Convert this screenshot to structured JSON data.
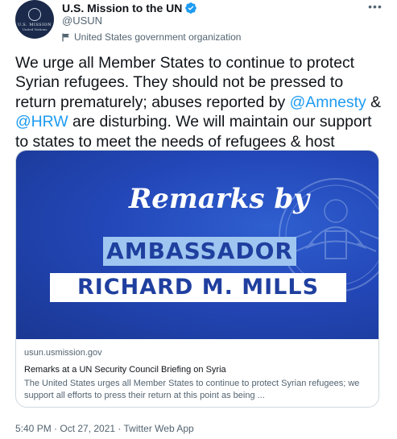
{
  "author": {
    "display_name": "U.S. Mission to the UN",
    "handle": "@USUN",
    "affiliation": "United States government organization",
    "avatar_text_1": "U.S. MISSION",
    "avatar_text_2": "United Nations"
  },
  "tweet": {
    "text_1": "We urge all Member States to continue to protect Syrian refugees. They should not be pressed to return prematurely; abuses reported by ",
    "mention_1": "@Amnesty",
    "text_2": " & ",
    "mention_2": "@HRW",
    "text_3": " are disturbing. We will maintain our support to states to meet the needs of refugees & host communities."
  },
  "card": {
    "image": {
      "line_1": "Remarks by",
      "line_2": "AMBASSADOR",
      "line_3": "RICHARD M. MILLS"
    },
    "domain": "usun.usmission.gov",
    "title": "Remarks at a UN Security Council Briefing on Syria",
    "description": "The United States urges all Member States to continue to protect Syrian refugees; we support all efforts to press their return at this point as being ..."
  },
  "meta": {
    "timestamp": "5:40 PM · Oct 27, 2021 · Twitter Web App"
  },
  "icons": {
    "verified": "verified-badge-icon",
    "affiliation": "government-flag-icon",
    "more": "more-options-icon"
  },
  "colors": {
    "link": "#1d9bf0",
    "card_bg": "#2347b8",
    "text_primary": "#0f1419",
    "text_secondary": "#536471"
  }
}
